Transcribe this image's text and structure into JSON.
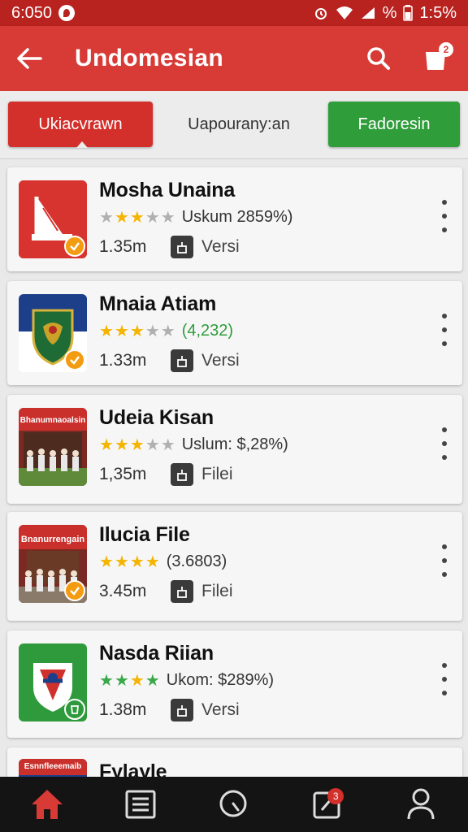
{
  "status_bar": {
    "time": "6:050",
    "battery_text": "%",
    "battery_percent": "1:5%"
  },
  "app_bar": {
    "title": "Undomesian",
    "cart_count": "2"
  },
  "tabs": [
    {
      "label": "Ukiacvrawn",
      "active": true
    },
    {
      "label": "Uapourany:an",
      "active": false
    },
    {
      "label": "Fadoresin",
      "active": false
    }
  ],
  "apps": [
    {
      "title": "Mosha Unaina",
      "stars": 3,
      "star_color": "yellow",
      "rating_text": "Uskum 2859%)",
      "size": "1.35m",
      "type": "Versi",
      "icon": "tablet-stand-icon",
      "badge": "check"
    },
    {
      "title": "Mnaia Atiam",
      "stars": 3,
      "star_color": "yellow",
      "rating_text": "(4,232)",
      "rating_green": true,
      "size": "1.33m",
      "type": "Versi",
      "icon": "shield-crest-icon",
      "badge": "check"
    },
    {
      "title": "Udeia Kisan",
      "stars": 3,
      "star_color": "yellow",
      "rating_text": "Uslum: $,28%)",
      "size": "1,35m",
      "type": "Filei",
      "icon": "crowd-photo-icon",
      "icon_label": "Bhanumnaoalsin",
      "badge": "none"
    },
    {
      "title": "Ilucia File",
      "stars": 4,
      "star_color": "yellow",
      "rating_text": "(3.6803)",
      "size": "3.45m",
      "type": "Filei",
      "icon": "crowd-photo-icon",
      "icon_label": "Bnanurrengain",
      "badge": "check"
    },
    {
      "title": "Nasda Riian",
      "stars": 4,
      "star_color": "green",
      "rating_text": "Ukom: $289%)",
      "size": "1.38m",
      "type": "Versi",
      "icon": "green-crest-icon",
      "badge": "cup"
    },
    {
      "title": "Fylayle",
      "icon_label": "Esnnfleeemaib"
    }
  ],
  "bottom_nav": {
    "items": [
      "home-icon",
      "list-icon",
      "search-icon",
      "edit-icon",
      "profile-icon"
    ],
    "badge_count": "3"
  },
  "colors": {
    "primary": "#d83a35",
    "status": "#b8221f",
    "green": "#2e9d3a",
    "star": "#f4b400",
    "nav": "#141414"
  }
}
